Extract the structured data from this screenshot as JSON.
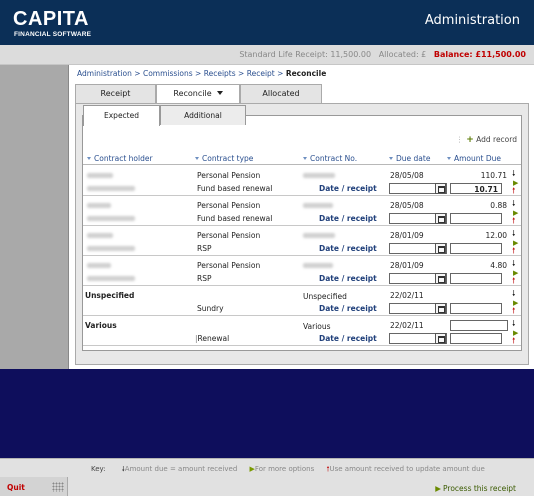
{
  "header": {
    "logo_main": "CAPITA",
    "logo_sub": "FINANCIAL SOFTWARE",
    "app_title": "Administration"
  },
  "status": {
    "receipt_text": "Standard Life Receipt: 11,500.00",
    "allocated_text": "Allocated: £",
    "balance_text": "Balance: £11,500.00"
  },
  "breadcrumb": {
    "items": [
      "Administration",
      "Commissions",
      "Receipts",
      "Receipt"
    ],
    "separator": ">",
    "current": "Reconcile"
  },
  "main_tabs": [
    {
      "label": "Receipt"
    },
    {
      "label": "Reconcile"
    },
    {
      "label": "Allocated"
    }
  ],
  "sub_tabs": [
    {
      "label": "Expected"
    },
    {
      "label": "Additional"
    }
  ],
  "add_record_label": "Add record",
  "columns": {
    "holder": "Contract holder",
    "type": "Contract type",
    "number": "Contract No.",
    "due_date": "Due date",
    "amount_due": "Amount Due"
  },
  "rows": [
    {
      "holder_bold": "",
      "type": "Personal Pension",
      "sub_type": "Fund based renewal",
      "contract_no": "",
      "date_receipt_label": "Date / receipt",
      "due_date": "28/05/08",
      "amount_due": "110.71",
      "amount_received": "10.71"
    },
    {
      "holder_bold": "",
      "type": "Personal Pension",
      "sub_type": "Fund based renewal",
      "contract_no": "",
      "date_receipt_label": "Date / receipt",
      "due_date": "28/05/08",
      "amount_due": "0.88",
      "amount_received": ""
    },
    {
      "holder_bold": "",
      "type": "Personal Pension",
      "sub_type": "RSP",
      "contract_no": "",
      "date_receipt_label": "Date / receipt",
      "due_date": "28/01/09",
      "amount_due": "12.00",
      "amount_received": ""
    },
    {
      "holder_bold": "",
      "type": "Personal Pension",
      "sub_type": "RSP",
      "contract_no": "",
      "date_receipt_label": "Date / receipt",
      "due_date": "28/01/09",
      "amount_due": "4.80",
      "amount_received": ""
    },
    {
      "holder_bold": "Unspecified",
      "type": "",
      "sub_type": "Sundry",
      "contract_no": "Unspecified",
      "date_receipt_label": "Date / receipt",
      "due_date": "22/02/11",
      "amount_due": "",
      "amount_received": ""
    },
    {
      "holder_bold": "Various",
      "type": "",
      "sub_type": "Renewal",
      "contract_no": "Various",
      "date_receipt_label": "Date / receipt",
      "due_date": "22/02/11",
      "amount_due": "",
      "amount_received": ""
    }
  ],
  "key": {
    "label": "Key:",
    "down": "Amount due = amount received",
    "green": "For more options",
    "red": "Use amount received to update amount due"
  },
  "quit_label": "Quit",
  "process_label": "Process this receipt",
  "icons": {
    "add": "plus-icon",
    "calendar": "calendar-icon",
    "copy": "down-arrow-icon",
    "options": "green-triangle-icon",
    "update": "red-up-arrow-icon"
  },
  "colors": {
    "header_bg": "#0b2f57",
    "balance": "#c00000",
    "link": "#2a4f8f",
    "background": "#0e0e5c"
  }
}
